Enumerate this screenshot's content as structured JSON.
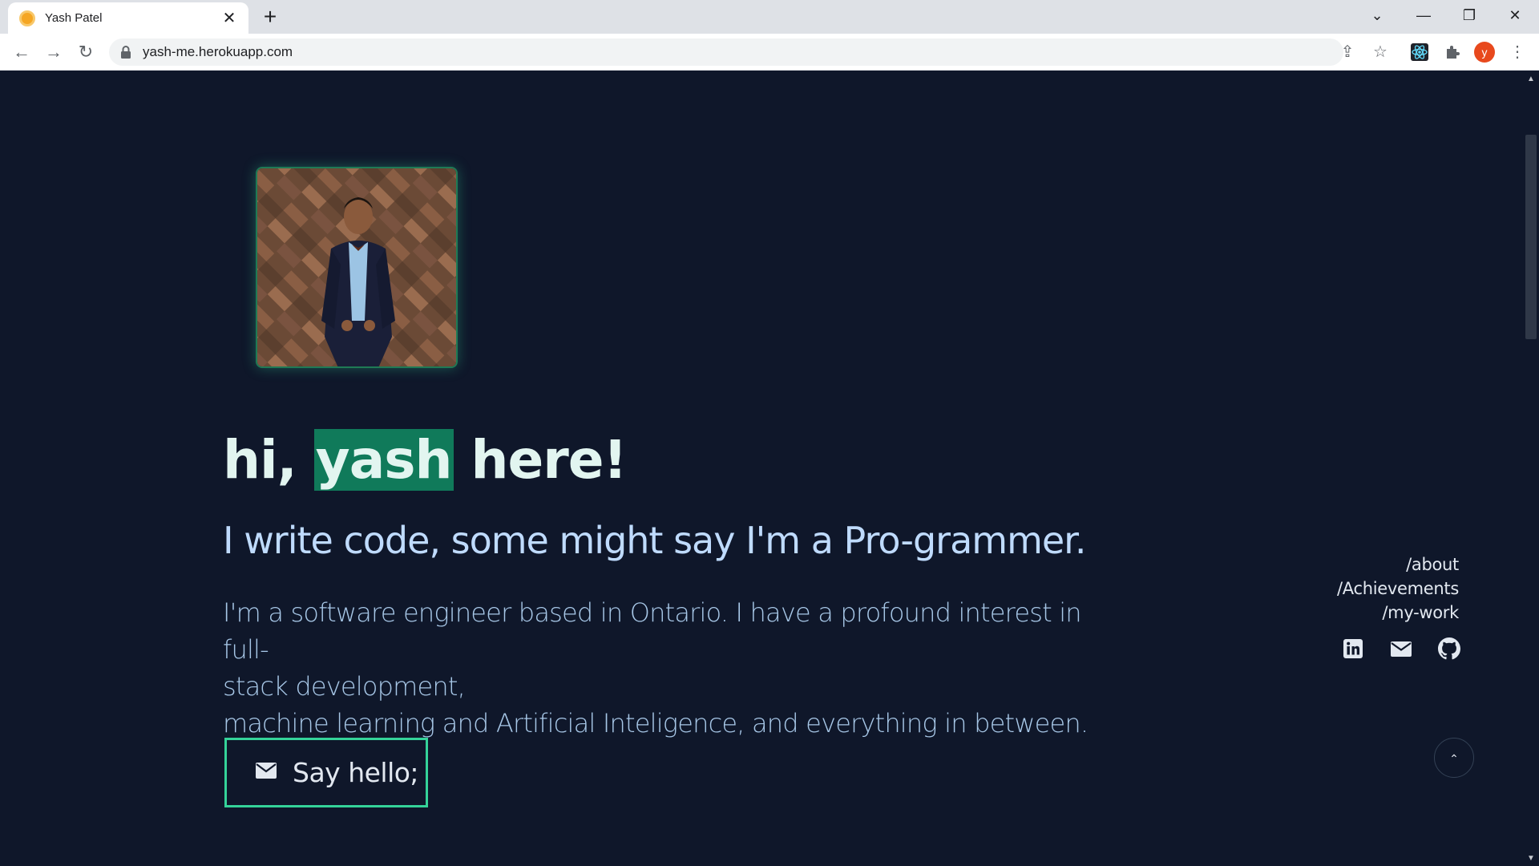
{
  "browser": {
    "tab_title": "Yash Patel",
    "tab_close": "✕",
    "new_tab": "+",
    "url": "yash-me.herokuapp.com",
    "profile_initial": "y",
    "window_controls": {
      "dropdown": "⌄",
      "minimize": "—",
      "restore": "❐",
      "close": "✕"
    },
    "nav": {
      "back": "←",
      "forward": "→",
      "reload": "↻"
    },
    "omni_actions": {
      "share": "⇪",
      "bookmark": "☆"
    },
    "menu": "⋮"
  },
  "hero": {
    "headline_prefix": "hi, ",
    "headline_name": "yash",
    "headline_suffix": " here!",
    "subheading": "I write code, some might say I'm a Pro-grammer.",
    "bio_lines": [
      "I'm a software engineer based in Ontario. I have a profound interest in full-",
      "stack development,",
      "machine learning and Artificial Inteligence, and everything in between."
    ],
    "cta_label": "Say hello;"
  },
  "sidebar_nav": {
    "links": [
      "/about",
      "/Achievements",
      "/my-work"
    ],
    "socials": [
      "linkedin-icon",
      "mail-icon",
      "github-icon"
    ]
  },
  "scroll_top": "⌃",
  "colors": {
    "background": "#0f172a",
    "accent": "#34d399",
    "highlight": "#107a5a",
    "headline": "#e2f5f0",
    "subheading": "#bfdbfe"
  }
}
